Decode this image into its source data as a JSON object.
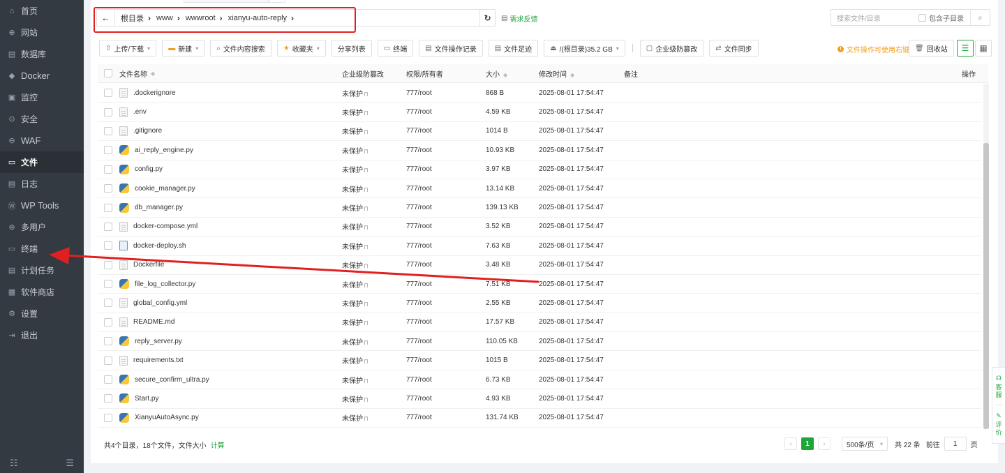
{
  "sidebar": {
    "items": [
      {
        "icon": "home-icon",
        "label": "首页"
      },
      {
        "icon": "globe-icon",
        "label": "网站"
      },
      {
        "icon": "database-icon",
        "label": "数据库"
      },
      {
        "icon": "docker-icon",
        "label": "Docker"
      },
      {
        "icon": "monitor-icon",
        "label": "监控"
      },
      {
        "icon": "shield-icon",
        "label": "安全"
      },
      {
        "icon": "waf-shield-icon",
        "label": "WAF"
      },
      {
        "icon": "folder-icon",
        "label": "文件"
      },
      {
        "icon": "log-icon",
        "label": "日志"
      },
      {
        "icon": "wordpress-icon",
        "label": "WP Tools"
      },
      {
        "icon": "users-icon",
        "label": "多用户"
      },
      {
        "icon": "terminal-icon",
        "label": "终端"
      },
      {
        "icon": "calendar-icon",
        "label": "计划任务"
      },
      {
        "icon": "grid-icon",
        "label": "软件商店"
      },
      {
        "icon": "gear-icon",
        "label": "设置"
      },
      {
        "icon": "logout-icon",
        "label": "退出"
      }
    ],
    "active_index": 7
  },
  "address": {
    "crumbs": [
      "根目录",
      "www",
      "wwwroot",
      "xianyu-auto-reply"
    ],
    "feedback": "需求反馈"
  },
  "search": {
    "placeholder": "搜索文件/目录",
    "include_sub": "包含子目录"
  },
  "toolbar": {
    "upload": "上传/下载",
    "new": "新建",
    "content_search": "文件内容搜索",
    "favorites": "收藏夹",
    "share_list": "分享列表",
    "terminal": "终端",
    "op_log": "文件操作记录",
    "footprint": "文件足迹",
    "disk": "/(根目录)35.2 GB",
    "tamper": "企业级防篡改",
    "sync": "文件同步",
    "tip": "文件操作可使用右键",
    "recycle": "回收站"
  },
  "table": {
    "headers": {
      "name": "文件名称",
      "protect": "企业级防篡改",
      "perm": "权限/所有者",
      "size": "大小",
      "mtime": "修改时间",
      "note": "备注",
      "op": "操作"
    },
    "rows": [
      {
        "type": "doc",
        "name": ".dockerignore",
        "protect": "未保护",
        "perm": "777/root",
        "size": "868 B",
        "mtime": "2025-08-01 17:54:47"
      },
      {
        "type": "doc",
        "name": ".env",
        "protect": "未保护",
        "perm": "777/root",
        "size": "4.59 KB",
        "mtime": "2025-08-01 17:54:47"
      },
      {
        "type": "doc",
        "name": ".gitignore",
        "protect": "未保护",
        "perm": "777/root",
        "size": "1014 B",
        "mtime": "2025-08-01 17:54:47"
      },
      {
        "type": "py",
        "name": "ai_reply_engine.py",
        "protect": "未保护",
        "perm": "777/root",
        "size": "10.93 KB",
        "mtime": "2025-08-01 17:54:47"
      },
      {
        "type": "py",
        "name": "config.py",
        "protect": "未保护",
        "perm": "777/root",
        "size": "3.97 KB",
        "mtime": "2025-08-01 17:54:47"
      },
      {
        "type": "py",
        "name": "cookie_manager.py",
        "protect": "未保护",
        "perm": "777/root",
        "size": "13.14 KB",
        "mtime": "2025-08-01 17:54:47"
      },
      {
        "type": "py",
        "name": "db_manager.py",
        "protect": "未保护",
        "perm": "777/root",
        "size": "139.13 KB",
        "mtime": "2025-08-01 17:54:47"
      },
      {
        "type": "doc",
        "name": "docker-compose.yml",
        "protect": "未保护",
        "perm": "777/root",
        "size": "3.52 KB",
        "mtime": "2025-08-01 17:54:47"
      },
      {
        "type": "sh",
        "name": "docker-deploy.sh",
        "protect": "未保护",
        "perm": "777/root",
        "size": "7.63 KB",
        "mtime": "2025-08-01 17:54:47"
      },
      {
        "type": "doc",
        "name": "Dockerfile",
        "protect": "未保护",
        "perm": "777/root",
        "size": "3.48 KB",
        "mtime": "2025-08-01 17:54:47"
      },
      {
        "type": "py",
        "name": "file_log_collector.py",
        "protect": "未保护",
        "perm": "777/root",
        "size": "7.51 KB",
        "mtime": "2025-08-01 17:54:47"
      },
      {
        "type": "doc",
        "name": "global_config.yml",
        "protect": "未保护",
        "perm": "777/root",
        "size": "2.55 KB",
        "mtime": "2025-08-01 17:54:47"
      },
      {
        "type": "doc",
        "name": "README.md",
        "protect": "未保护",
        "perm": "777/root",
        "size": "17.57 KB",
        "mtime": "2025-08-01 17:54:47"
      },
      {
        "type": "py",
        "name": "reply_server.py",
        "protect": "未保护",
        "perm": "777/root",
        "size": "110.05 KB",
        "mtime": "2025-08-01 17:54:47"
      },
      {
        "type": "doc",
        "name": "requirements.txt",
        "protect": "未保护",
        "perm": "777/root",
        "size": "1015 B",
        "mtime": "2025-08-01 17:54:47"
      },
      {
        "type": "py",
        "name": "secure_confirm_ultra.py",
        "protect": "未保护",
        "perm": "777/root",
        "size": "6.73 KB",
        "mtime": "2025-08-01 17:54:47"
      },
      {
        "type": "py",
        "name": "Start.py",
        "protect": "未保护",
        "perm": "777/root",
        "size": "4.93 KB",
        "mtime": "2025-08-01 17:54:47"
      },
      {
        "type": "py",
        "name": "XianyuAutoAsync.py",
        "protect": "未保护",
        "perm": "777/root",
        "size": "131.74 KB",
        "mtime": "2025-08-01 17:54:47"
      }
    ]
  },
  "footer": {
    "summary": "共4个目录，18个文件，文件大小",
    "calc": "计算",
    "current_page": "1",
    "per_page": "500条/页",
    "total": "共 22 条",
    "goto": "前往",
    "goto_value": "1",
    "page_unit": "页"
  },
  "float": {
    "service": "客服",
    "review": "评价"
  },
  "colors": {
    "accent": "#20a53a",
    "sidebar_bg": "#333a41",
    "annotation": "#e02020",
    "warning": "#f0a020"
  }
}
